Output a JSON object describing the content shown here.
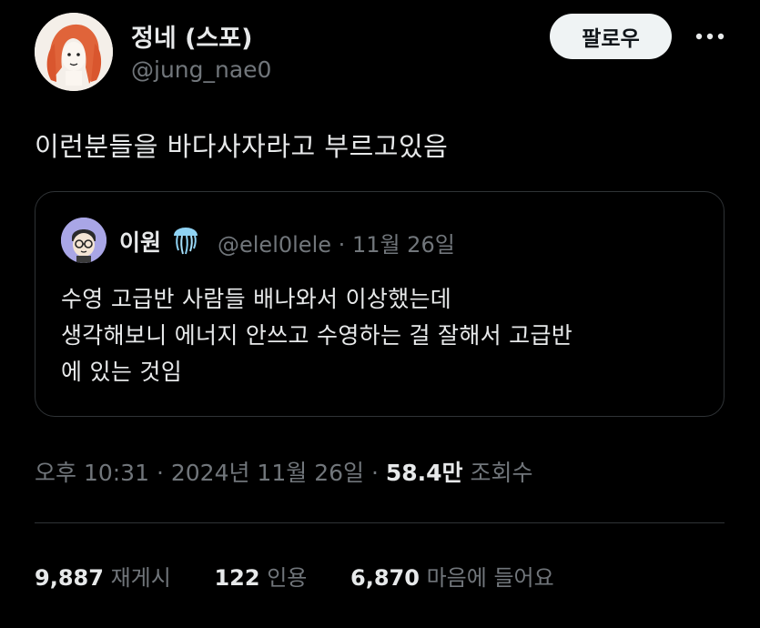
{
  "author": {
    "display_name": "정네 (스포)",
    "handle": "@jung_nae0"
  },
  "follow_label": "팔로우",
  "more_icon": "more-horizontal-icon",
  "tweet_text": "이런분들을 바다사자라고 부르고있음",
  "quote": {
    "name": "이원",
    "emoji_icon": "jellyfish-icon",
    "handle": "@elel0lele",
    "separator": "·",
    "date": "11월 26일",
    "lines": [
      "수영 고급반 사람들 배나와서 이상했는데",
      "생각해보니 에너지 안쓰고 수영하는 걸 잘해서 고급반",
      "에 있는 것임"
    ]
  },
  "meta": {
    "time": "오후 10:31",
    "sep1": "·",
    "date": "2024년 11월 26일",
    "sep2": "·",
    "views_count": "58.4만",
    "views_label": "조회수"
  },
  "stats": {
    "reposts_count": "9,887",
    "reposts_label": "재게시",
    "quotes_count": "122",
    "quotes_label": "인용",
    "likes_count": "6,870",
    "likes_label": "마음에 들어요"
  },
  "colors": {
    "background": "#000000",
    "text": "#e7e9ea",
    "muted": "#71767b",
    "border": "#2f3336",
    "button_bg": "#eff3f4"
  }
}
